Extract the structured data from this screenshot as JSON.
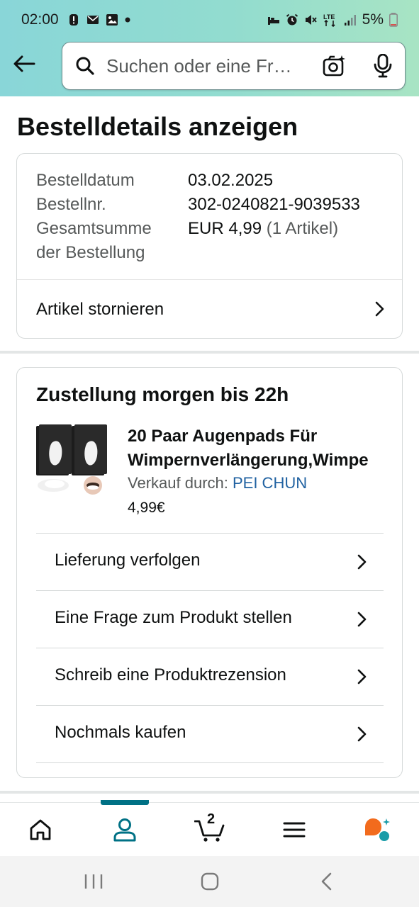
{
  "status_bar": {
    "time": "02:00",
    "battery": "5%",
    "network": "LTE"
  },
  "search": {
    "placeholder": "Suchen oder eine Fr…"
  },
  "page": {
    "title": "Bestelldetails anzeigen"
  },
  "order_summary": {
    "date_label": "Bestelldatum",
    "date_value": "03.02.2025",
    "number_label": "Bestellnr.",
    "number_value": "302-0240821-9039533",
    "total_label_line1": "Gesamtsumme",
    "total_label_line2": "der Bestellung",
    "total_value": "EUR 4,99",
    "total_items": "(1 Artikel)",
    "cancel_label": "Artikel stornieren"
  },
  "delivery": {
    "heading": "Zustellung morgen bis 22h",
    "product_title_line1": "20 Paar Augenpads Für",
    "product_title_line2": "Wimpernverlängerung,Wimpe",
    "sold_by_label": "Verkauf durch: ",
    "seller": "PEI CHUN",
    "price": "4,99€",
    "actions": [
      "Lieferung verfolgen",
      "Eine Frage zum Produkt stellen",
      "Schreib eine Produktrezension",
      "Nochmals kaufen"
    ]
  },
  "bottom_nav": {
    "cart_count": "2",
    "active_tab": "account"
  },
  "colors": {
    "header_gradient_start": "#89d6d8",
    "header_gradient_end": "#a8e4c4",
    "active_teal": "#007185",
    "link_blue": "#2162a1",
    "rufus_orange": "#f26b1d"
  }
}
